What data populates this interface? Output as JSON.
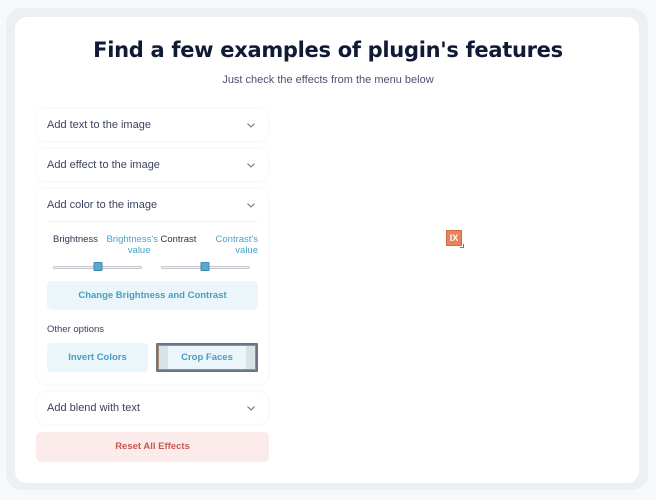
{
  "header": {
    "title": "Find a few examples of plugin's features",
    "subtitle": "Just check the effects from the menu below"
  },
  "accordion": [
    {
      "label": "Add text to the image",
      "expanded": false
    },
    {
      "label": "Add effect to the image",
      "expanded": false
    },
    {
      "label": "Add color to the image",
      "expanded": true,
      "sliders": [
        {
          "name": "Brightness",
          "value_text": "Brightness's value",
          "value_fraction": 0.5
        },
        {
          "name": "Contrast",
          "value_text": "Contrast's value",
          "value_fraction": 0.5
        }
      ],
      "apply_button": "Change Brightness and Contrast",
      "other_options_label": "Other options",
      "options": [
        {
          "label": "Invert Colors",
          "focused": false
        },
        {
          "label": "Crop Faces",
          "focused": true
        }
      ]
    },
    {
      "label": "Add blend with text",
      "expanded": false
    }
  ],
  "reset_button": "Reset All Effects",
  "preview": {
    "image_state": "broken-image-icon",
    "icon_text": "IX"
  },
  "colors": {
    "accent": "#4a9dc1",
    "accent_bg": "#eaf6f9",
    "danger": "#c8584f",
    "danger_bg": "#fbeceb",
    "title": "#111a35"
  }
}
